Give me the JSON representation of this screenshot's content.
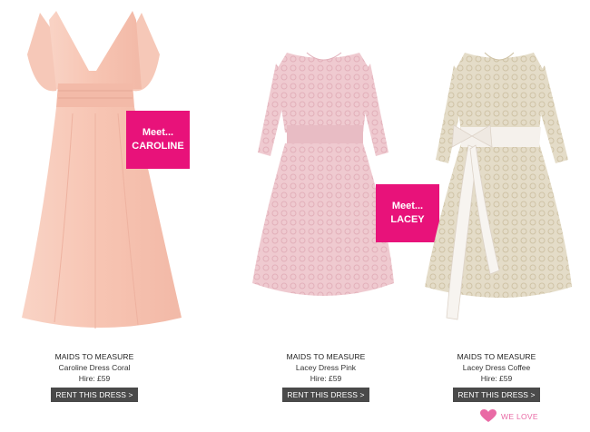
{
  "products": [
    {
      "brand": "MAIDS TO MEASURE",
      "name": "Caroline Dress Coral",
      "price": "Hire: £59",
      "button": "RENT THIS DRESS >",
      "dress_color": "#f7c7b6",
      "meet": {
        "line1": "Meet...",
        "line2": "CAROLINE"
      }
    },
    {
      "brand": "MAIDS TO MEASURE",
      "name": "Lacey Dress Pink",
      "price": "Hire: £59",
      "button": "RENT THIS DRESS >",
      "dress_color": "#edc7cc",
      "meet": {
        "line1": "Meet...",
        "line2": "LACEY"
      }
    },
    {
      "brand": "MAIDS TO MEASURE",
      "name": "Lacey Dress Coffee",
      "price": "Hire: £59",
      "button": "RENT THIS DRESS >",
      "dress_color": "#e0d8c2"
    }
  ],
  "we_love": {
    "label": "WE LOVE",
    "icon": "heart-icon",
    "color": "#e96aa5"
  },
  "accent": "#e8127a"
}
